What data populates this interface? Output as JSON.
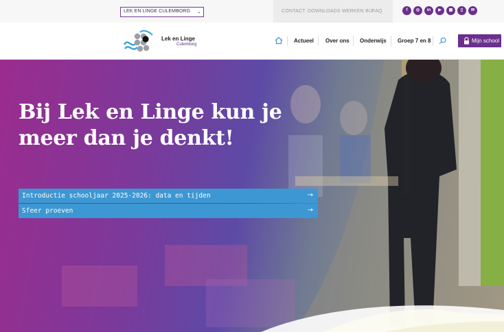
{
  "topbar": {
    "school_select": "LEK EN LINGE CULEMBORG",
    "links": [
      "CONTACT",
      "DOWNLOADS",
      "WERKEN BIJ",
      "FAQ"
    ],
    "social_icons": [
      "facebook-icon",
      "instagram-icon",
      "linkedin-icon",
      "youtube-icon",
      "school-app-icon",
      "parnassys-icon",
      "mail-icon"
    ],
    "social_glyphs": [
      "f",
      "◎",
      "in",
      "▶",
      "▦",
      "▯",
      "✉"
    ]
  },
  "header": {
    "logo_title": "Lek en Linge",
    "logo_subtitle": "Culemborg",
    "nav": [
      "Actueel",
      "Over ons",
      "Onderwijs",
      "Groep 7 en 8"
    ],
    "mijn_school": "Mijn school"
  },
  "hero": {
    "title_line1": "Bij Lek en Linge kun je",
    "title_line2": "meer dan je denkt!",
    "links": [
      {
        "label": "Introductie schooljaar 2025-2026: data en tijden",
        "arrow": "→"
      },
      {
        "label": "Sfeer proeven",
        "arrow": "→"
      }
    ]
  },
  "colors": {
    "brand_purple": "#6b2f8d",
    "link_blue": "#3d97d2",
    "hero_magenta": "#9b2c8e"
  }
}
